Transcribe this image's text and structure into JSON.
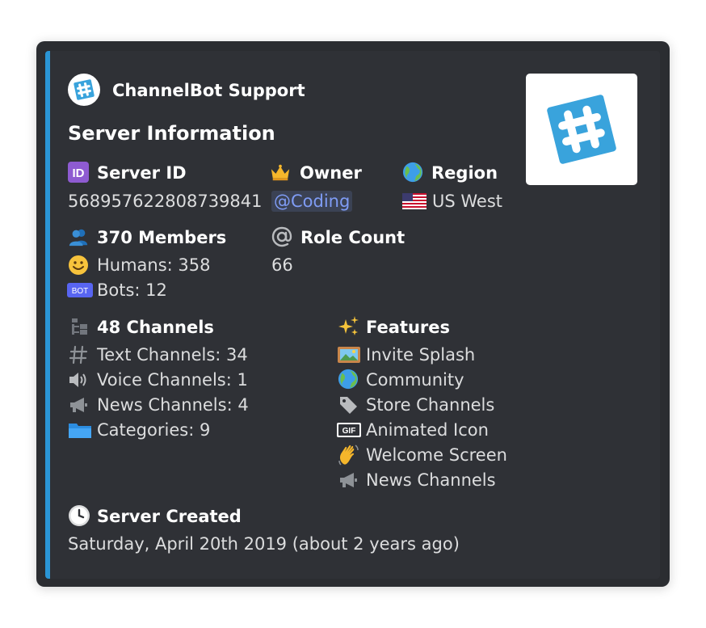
{
  "author": {
    "name": "ChannelBot Support"
  },
  "title": "Server Information",
  "server_id": {
    "label": "Server ID",
    "value": "568957622808739841"
  },
  "owner": {
    "label": "Owner",
    "value": "@Coding"
  },
  "region": {
    "label": "Region",
    "value": "US West"
  },
  "members": {
    "label": "370 Members",
    "humans": "Humans: 358",
    "bots": "Bots: 12"
  },
  "roles": {
    "label": "Role Count",
    "value": "66"
  },
  "channels": {
    "label": "48 Channels",
    "items": [
      "Text Channels: 34",
      "Voice Channels: 1",
      "News Channels: 4",
      "Categories: 9"
    ]
  },
  "features": {
    "label": "Features",
    "items": [
      "Invite Splash",
      "Community",
      "Store Channels",
      "Animated Icon",
      "Welcome Screen",
      "News Channels"
    ]
  },
  "created": {
    "label": "Server Created",
    "value": "Saturday, April 20th 2019 (about 2 years ago)"
  },
  "icons": {
    "author": "hashtag-logo-icon",
    "thumbnail": "hashtag-logo-icon",
    "server_id": "id-badge-icon",
    "owner": "crown-icon",
    "region": "globe-icon",
    "region_flag": "us-flag-icon",
    "members": "people-icon",
    "humans": "smiley-icon",
    "bots": "bot-tag-icon",
    "roles": "at-sign-icon",
    "channels": "channel-tree-icon",
    "text": "hashtag-icon",
    "voice": "speaker-icon",
    "news": "megaphone-icon",
    "categories": "folder-icon",
    "features": "sparkles-icon",
    "invite_splash": "picture-icon",
    "community": "globe-icon",
    "store": "tag-icon",
    "animated": "gif-icon",
    "welcome": "waving-hand-icon",
    "news_feature": "megaphone-icon",
    "created": "clock-icon"
  },
  "colors": {
    "accent_bar": "#2a95d5",
    "embed_bg": "#2f3136",
    "mention": "#7f9cf5",
    "logo_blue": "#39a3dc"
  }
}
